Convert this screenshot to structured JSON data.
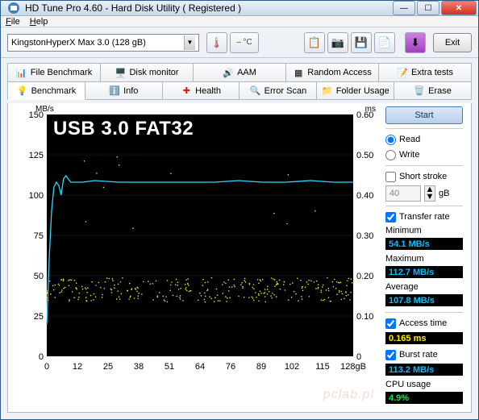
{
  "window": {
    "title": "HD Tune Pro 4.60 - Hard Disk Utility ( Registered )",
    "min": "—",
    "max": "☐",
    "close": "✕"
  },
  "menu": {
    "file": "File",
    "help": "Help"
  },
  "toolbar": {
    "device": "KingstonHyperX Max 3.0 (128 gB)",
    "temp": "– °C",
    "exit": "Exit"
  },
  "tabs_row1": [
    {
      "label": "File Benchmark"
    },
    {
      "label": "Disk monitor"
    },
    {
      "label": "AAM"
    },
    {
      "label": "Random Access"
    },
    {
      "label": "Extra tests"
    }
  ],
  "tabs_row2": [
    {
      "label": "Benchmark"
    },
    {
      "label": "Info"
    },
    {
      "label": "Health"
    },
    {
      "label": "Error Scan"
    },
    {
      "label": "Folder Usage"
    },
    {
      "label": "Erase"
    }
  ],
  "side": {
    "start": "Start",
    "read": "Read",
    "write": "Write",
    "short_stroke": "Short stroke",
    "stroke_val": "40",
    "stroke_unit": "gB",
    "transfer_rate": "Transfer rate",
    "min_l": "Minimum",
    "min_v": "54.1 MB/s",
    "max_l": "Maximum",
    "max_v": "112.7 MB/s",
    "avg_l": "Average",
    "avg_v": "107.8 MB/s",
    "access_l": "Access time",
    "access_v": "0.165 ms",
    "burst_l": "Burst rate",
    "burst_v": "113.2 MB/s",
    "cpu_l": "CPU usage",
    "cpu_v": "4.9%"
  },
  "overlay": "USB 3.0 FAT32",
  "axis": {
    "left_unit": "MB/s",
    "right_unit": "ms",
    "y_left": [
      "150",
      "125",
      "100",
      "75",
      "50",
      "25",
      "0"
    ],
    "y_right": [
      "0.60",
      "0.50",
      "0.40",
      "0.30",
      "0.20",
      "0.10",
      "0"
    ],
    "x": [
      "0",
      "12",
      "25",
      "38",
      "51",
      "64",
      "76",
      "89",
      "102",
      "115",
      "128gB"
    ]
  },
  "chart_data": {
    "type": "line",
    "title": "USB 3.0 FAT32",
    "xlabel": "gB",
    "ylabel_left": "MB/s",
    "ylabel_right": "ms",
    "xlim": [
      0,
      128
    ],
    "ylim_left": [
      0,
      150
    ],
    "ylim_right": [
      0,
      0.6
    ],
    "series": [
      {
        "name": "Transfer rate (MB/s)",
        "axis": "left",
        "color": "#20d0ff",
        "x": [
          0,
          1,
          2,
          3,
          4,
          5,
          6,
          7,
          8,
          10,
          15,
          20,
          30,
          40,
          50,
          60,
          70,
          80,
          90,
          100,
          110,
          120,
          128
        ],
        "values": [
          20,
          60,
          90,
          105,
          108,
          106,
          100,
          110,
          112,
          108,
          108,
          109,
          108,
          108,
          108,
          108,
          108,
          109,
          108,
          108,
          109,
          108,
          108
        ]
      },
      {
        "name": "Access time (ms)",
        "axis": "right",
        "color": "#f0e020",
        "style": "scatter",
        "x": [
          0,
          10,
          20,
          30,
          40,
          50,
          60,
          70,
          80,
          90,
          100,
          110,
          120,
          128
        ],
        "values": [
          0.18,
          0.17,
          0.16,
          0.17,
          0.16,
          0.16,
          0.17,
          0.16,
          0.17,
          0.16,
          0.17,
          0.16,
          0.17,
          0.17
        ]
      }
    ]
  }
}
